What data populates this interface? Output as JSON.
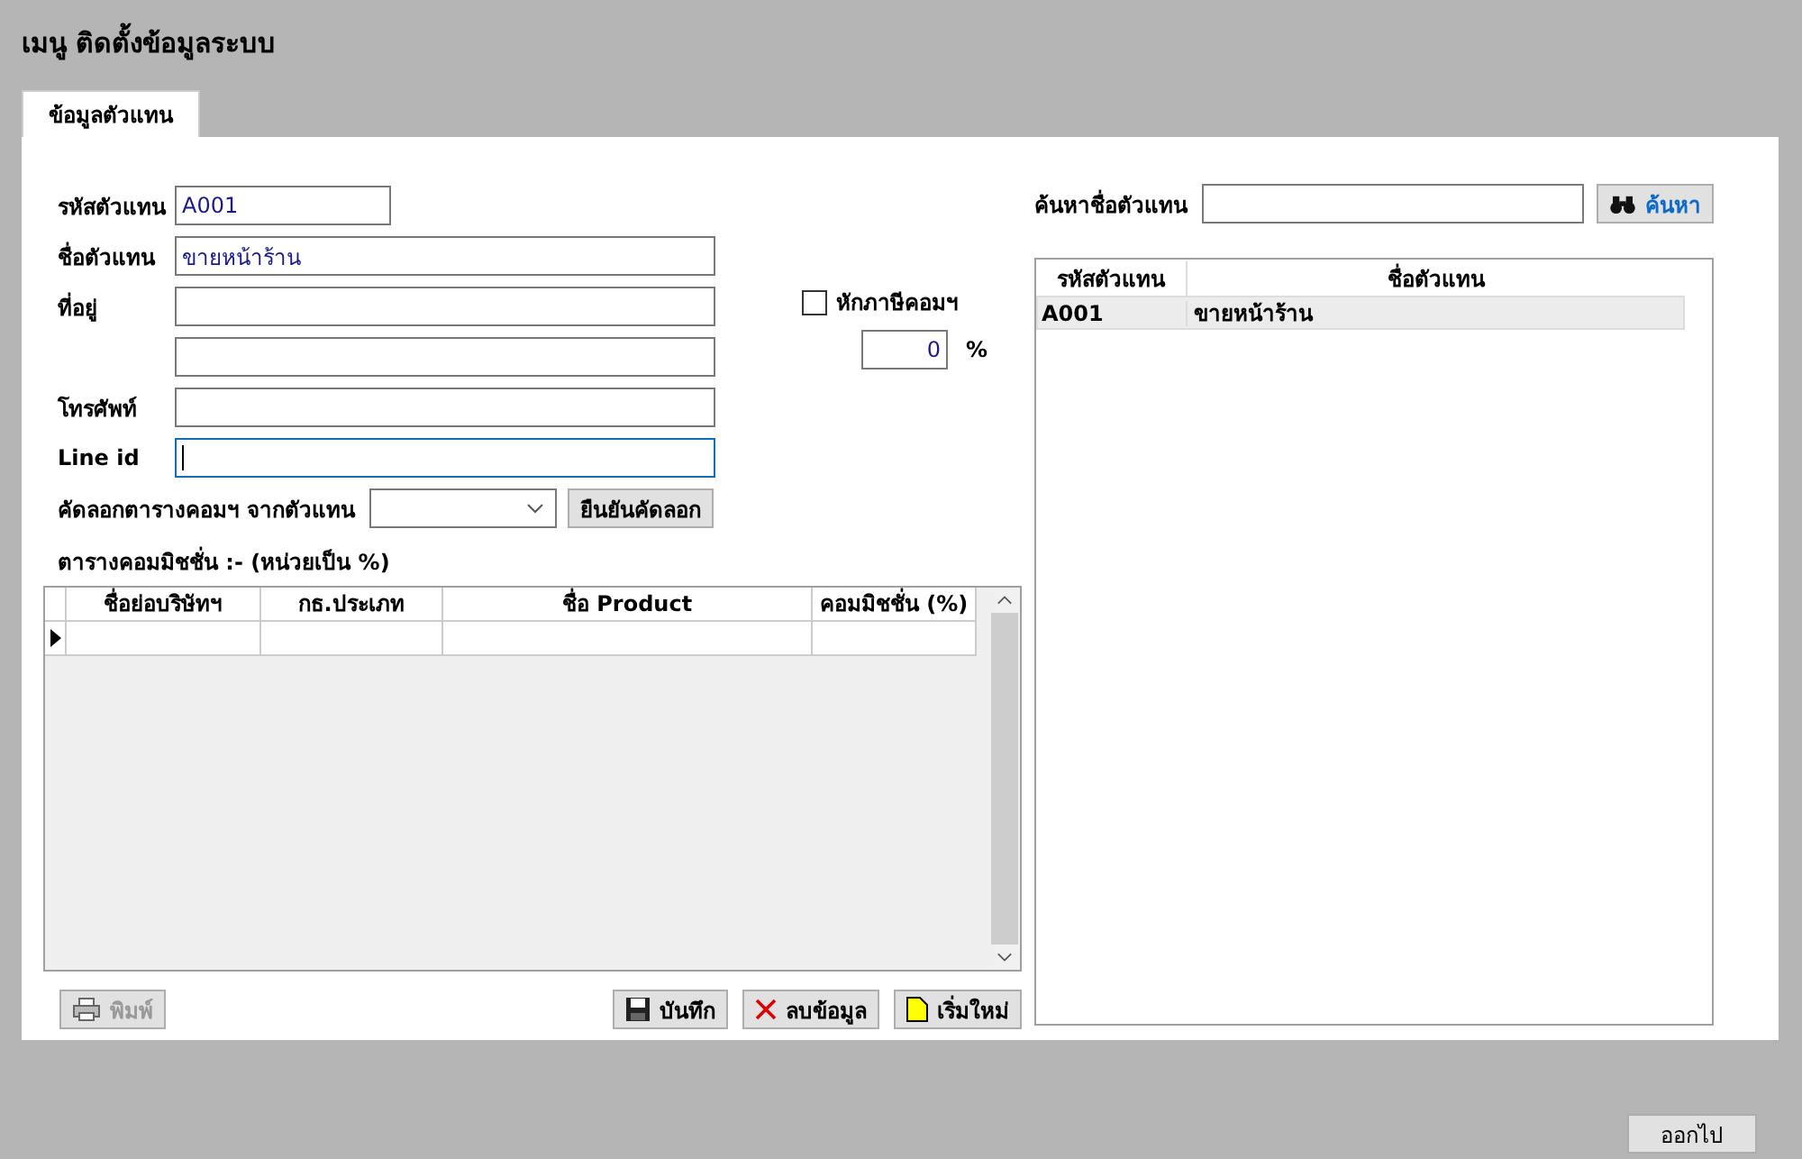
{
  "window": {
    "title": "เมนู ติดตั้งข้อมูลระบบ"
  },
  "tabs": [
    {
      "label": "ข้อมูลตัวแทน",
      "selected": true
    }
  ],
  "form": {
    "fields": [
      {
        "label": "รหัสตัวแทน",
        "value": "A001",
        "kind": "short",
        "focused": false
      },
      {
        "label": "ชื่อตัวแทน",
        "value": "ขายหน้าร้าน",
        "kind": "long",
        "focused": false
      },
      {
        "label": "ที่อยู่",
        "kind": "long",
        "focused": false
      },
      {
        "kind": "long",
        "focused": false
      },
      {
        "label": "โทรศัพท์",
        "kind": "long",
        "focused": false
      },
      {
        "label": "Line id",
        "kind": "long",
        "focused": true
      }
    ]
  },
  "tax": {
    "label": "หักภาษีคอมฯ",
    "checked": false,
    "rate": "0",
    "unit": "%"
  },
  "copy": {
    "label": "คัดลอกตารางคอมฯ จากตัวแทน",
    "button": "ยืนยันคัดลอก"
  },
  "commission": {
    "caption": "ตารางคอมมิชชั่น :-  (หน่วยเป็น %)",
    "columns": [
      "ชื่อย่อบริษัทฯ",
      "กธ.ประเภท",
      "ชื่อ Product",
      "คอมมิชชั่น (%)"
    ]
  },
  "actions": [
    {
      "label": "พิมพ์",
      "kind": "print",
      "disabled": true
    },
    {
      "label": "บันทึก",
      "kind": "save",
      "disabled": false
    },
    {
      "label": "ลบข้อมูล",
      "kind": "delete",
      "disabled": false
    },
    {
      "label": "เริ่มใหม่",
      "kind": "new",
      "disabled": false
    }
  ],
  "search": {
    "label": "ค้นหาชื่อตัวแทน",
    "button": "ค้นหา"
  },
  "agents": {
    "columns": [
      "รหัสตัวแทน",
      "ชื่อตัวแทน"
    ],
    "rows": [
      {
        "code": "A001",
        "name": "ขายหน้าร้าน",
        "selected": true
      }
    ]
  },
  "exit_button": "ออกไป"
}
